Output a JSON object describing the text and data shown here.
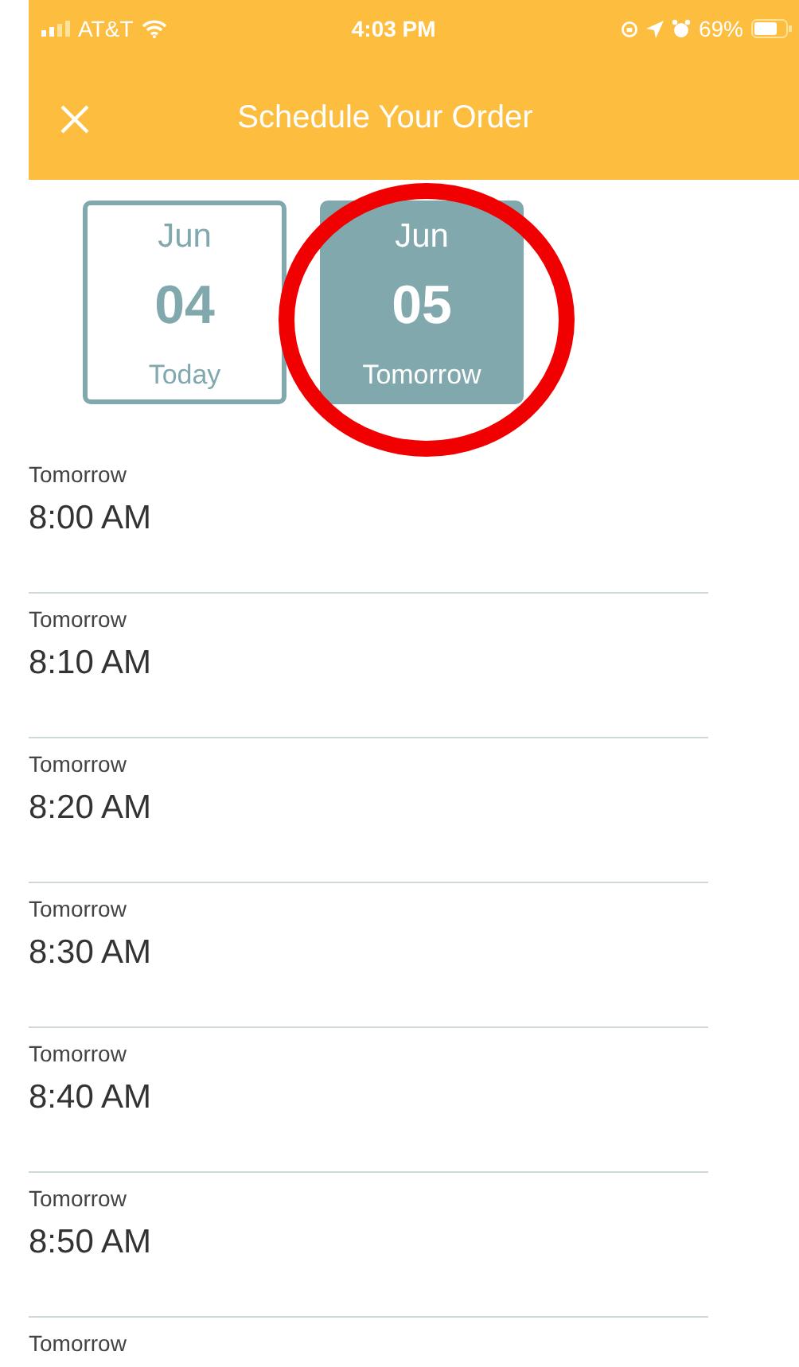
{
  "status_bar": {
    "carrier": "AT&T",
    "time": "4:03 PM",
    "battery": "69%"
  },
  "header": {
    "title": "Schedule Your Order"
  },
  "dates": [
    {
      "month": "Jun",
      "day": "04",
      "label": "Today",
      "selected": false
    },
    {
      "month": "Jun",
      "day": "05",
      "label": "Tomorrow",
      "selected": true
    }
  ],
  "slots": [
    {
      "day": "Tomorrow",
      "time": "8:00 AM"
    },
    {
      "day": "Tomorrow",
      "time": "8:10 AM"
    },
    {
      "day": "Tomorrow",
      "time": "8:20 AM"
    },
    {
      "day": "Tomorrow",
      "time": "8:30 AM"
    },
    {
      "day": "Tomorrow",
      "time": "8:40 AM"
    },
    {
      "day": "Tomorrow",
      "time": "8:50 AM"
    },
    {
      "day": "Tomorrow"
    }
  ]
}
